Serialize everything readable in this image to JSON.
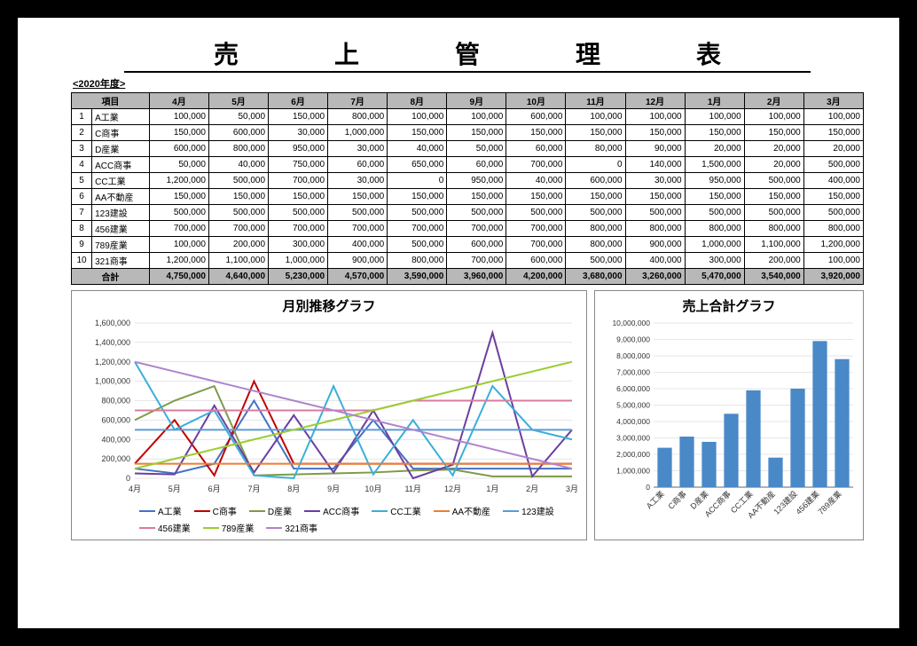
{
  "title": "売　上　管　理　表",
  "year_label": "<2020年度>",
  "header": {
    "item": "項目",
    "months": [
      "4月",
      "5月",
      "6月",
      "7月",
      "8月",
      "9月",
      "10月",
      "11月",
      "12月",
      "1月",
      "2月",
      "3月"
    ]
  },
  "rows": [
    {
      "num": "1",
      "name": "A工業",
      "vals": [
        "100,000",
        "50,000",
        "150,000",
        "800,000",
        "100,000",
        "100,000",
        "600,000",
        "100,000",
        "100,000",
        "100,000",
        "100,000",
        "100,000"
      ]
    },
    {
      "num": "2",
      "name": "C商事",
      "vals": [
        "150,000",
        "600,000",
        "30,000",
        "1,000,000",
        "150,000",
        "150,000",
        "150,000",
        "150,000",
        "150,000",
        "150,000",
        "150,000",
        "150,000"
      ]
    },
    {
      "num": "3",
      "name": "D産業",
      "vals": [
        "600,000",
        "800,000",
        "950,000",
        "30,000",
        "40,000",
        "50,000",
        "60,000",
        "80,000",
        "90,000",
        "20,000",
        "20,000",
        "20,000"
      ]
    },
    {
      "num": "4",
      "name": "ACC商事",
      "vals": [
        "50,000",
        "40,000",
        "750,000",
        "60,000",
        "650,000",
        "60,000",
        "700,000",
        "0",
        "140,000",
        "1,500,000",
        "20,000",
        "500,000"
      ]
    },
    {
      "num": "5",
      "name": "CC工業",
      "vals": [
        "1,200,000",
        "500,000",
        "700,000",
        "30,000",
        "0",
        "950,000",
        "40,000",
        "600,000",
        "30,000",
        "950,000",
        "500,000",
        "400,000"
      ]
    },
    {
      "num": "6",
      "name": "AA不動産",
      "vals": [
        "150,000",
        "150,000",
        "150,000",
        "150,000",
        "150,000",
        "150,000",
        "150,000",
        "150,000",
        "150,000",
        "150,000",
        "150,000",
        "150,000"
      ]
    },
    {
      "num": "7",
      "name": "123建設",
      "vals": [
        "500,000",
        "500,000",
        "500,000",
        "500,000",
        "500,000",
        "500,000",
        "500,000",
        "500,000",
        "500,000",
        "500,000",
        "500,000",
        "500,000"
      ]
    },
    {
      "num": "8",
      "name": "456建業",
      "vals": [
        "700,000",
        "700,000",
        "700,000",
        "700,000",
        "700,000",
        "700,000",
        "700,000",
        "800,000",
        "800,000",
        "800,000",
        "800,000",
        "800,000"
      ]
    },
    {
      "num": "9",
      "name": "789産業",
      "vals": [
        "100,000",
        "200,000",
        "300,000",
        "400,000",
        "500,000",
        "600,000",
        "700,000",
        "800,000",
        "900,000",
        "1,000,000",
        "1,100,000",
        "1,200,000"
      ]
    },
    {
      "num": "10",
      "name": "321商事",
      "vals": [
        "1,200,000",
        "1,100,000",
        "1,000,000",
        "900,000",
        "800,000",
        "700,000",
        "600,000",
        "500,000",
        "400,000",
        "300,000",
        "200,000",
        "100,000"
      ]
    }
  ],
  "total": {
    "label": "合計",
    "vals": [
      "4,750,000",
      "4,640,000",
      "5,230,000",
      "4,570,000",
      "3,590,000",
      "3,960,000",
      "4,200,000",
      "3,680,000",
      "3,260,000",
      "5,470,000",
      "3,540,000",
      "3,920,000"
    ]
  },
  "chart_data": [
    {
      "type": "line",
      "title": "月別推移グラフ",
      "xlabel": "",
      "ylabel": "",
      "ylim": [
        0,
        1600000
      ],
      "yticks": [
        0,
        200000,
        400000,
        600000,
        800000,
        1000000,
        1200000,
        1400000,
        1600000
      ],
      "categories": [
        "4月",
        "5月",
        "6月",
        "7月",
        "8月",
        "9月",
        "10月",
        "11月",
        "12月",
        "1月",
        "2月",
        "3月"
      ],
      "series": [
        {
          "name": "A工業",
          "color": "#4472c4",
          "values": [
            100000,
            50000,
            150000,
            800000,
            100000,
            100000,
            600000,
            100000,
            100000,
            100000,
            100000,
            100000
          ]
        },
        {
          "name": "C商事",
          "color": "#c00000",
          "values": [
            150000,
            600000,
            30000,
            1000000,
            150000,
            150000,
            150000,
            150000,
            150000,
            150000,
            150000,
            150000
          ]
        },
        {
          "name": "D産業",
          "color": "#7f9a48",
          "values": [
            600000,
            800000,
            950000,
            30000,
            40000,
            50000,
            60000,
            80000,
            90000,
            20000,
            20000,
            20000
          ]
        },
        {
          "name": "ACC商事",
          "color": "#6b3fa0",
          "values": [
            50000,
            40000,
            750000,
            60000,
            650000,
            60000,
            700000,
            0,
            140000,
            1500000,
            20000,
            500000
          ]
        },
        {
          "name": "CC工業",
          "color": "#3bafda",
          "values": [
            1200000,
            500000,
            700000,
            30000,
            0,
            950000,
            40000,
            600000,
            30000,
            950000,
            500000,
            400000
          ]
        },
        {
          "name": "AA不動産",
          "color": "#ed7d31",
          "values": [
            150000,
            150000,
            150000,
            150000,
            150000,
            150000,
            150000,
            150000,
            150000,
            150000,
            150000,
            150000
          ]
        },
        {
          "name": "123建設",
          "color": "#5b9bd5",
          "values": [
            500000,
            500000,
            500000,
            500000,
            500000,
            500000,
            500000,
            500000,
            500000,
            500000,
            500000,
            500000
          ]
        },
        {
          "name": "456建業",
          "color": "#d87ba0",
          "values": [
            700000,
            700000,
            700000,
            700000,
            700000,
            700000,
            700000,
            800000,
            800000,
            800000,
            800000,
            800000
          ]
        },
        {
          "name": "789産業",
          "color": "#9acd32",
          "values": [
            100000,
            200000,
            300000,
            400000,
            500000,
            600000,
            700000,
            800000,
            900000,
            1000000,
            1100000,
            1200000
          ]
        },
        {
          "name": "321商事",
          "color": "#b084cc",
          "values": [
            1200000,
            1100000,
            1000000,
            900000,
            800000,
            700000,
            600000,
            500000,
            400000,
            300000,
            200000,
            100000
          ]
        }
      ]
    },
    {
      "type": "bar",
      "title": "売上合計グラフ",
      "xlabel": "",
      "ylabel": "",
      "ylim": [
        0,
        10000000
      ],
      "yticks": [
        0,
        1000000,
        2000000,
        3000000,
        4000000,
        5000000,
        6000000,
        7000000,
        8000000,
        9000000,
        10000000
      ],
      "categories": [
        "A工業",
        "C商事",
        "D産業",
        "ACC商事",
        "CC工業",
        "AA不動産",
        "123建設",
        "456建業",
        "789産業"
      ],
      "values": [
        2400000,
        3080000,
        2760000,
        4470000,
        5900000,
        1800000,
        6000000,
        8900000,
        7800000
      ],
      "color": "#4a89c8"
    }
  ]
}
